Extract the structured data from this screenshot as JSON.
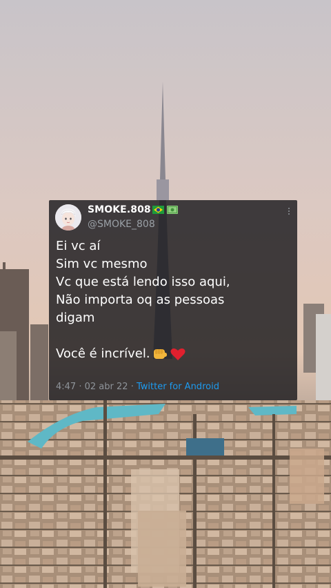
{
  "tweet": {
    "display_name": "SMOKE.808",
    "handle": "@SMOKE_808",
    "lines": [
      "Ei vc aí",
      "Sim vc mesmo",
      "Vc que está lendo isso aqui,",
      "Não importa oq as pessoas",
      "digam"
    ],
    "closing_line": "Você é incrível.",
    "time": "4:47",
    "date": "02 abr 22",
    "source": "Twitter for Android",
    "separator": "·"
  },
  "icons": [
    "brazil-flag-icon",
    "money-icon",
    "more-options-icon",
    "fist-icon",
    "heart-icon"
  ],
  "colors": {
    "link": "#1d9bf0",
    "card_bg": "#16161a",
    "heart": "#e0202e"
  }
}
